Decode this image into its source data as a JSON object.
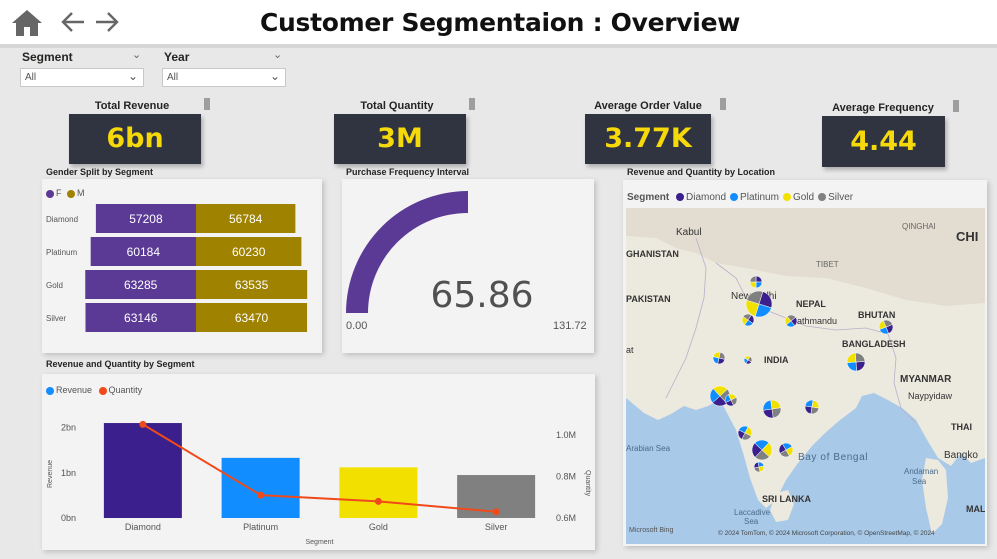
{
  "title": "Customer Segmentaion : Overview",
  "filters": {
    "segment": {
      "label": "Segment",
      "value": "All"
    },
    "year": {
      "label": "Year",
      "value": "All"
    }
  },
  "kpis": {
    "revenue": {
      "label": "Total Revenue",
      "value": "6bn"
    },
    "quantity": {
      "label": "Total Quantity",
      "value": "3M"
    },
    "aov": {
      "label": "Average Order Value",
      "value": "3.77K"
    },
    "frequency": {
      "label": "Average Frequency",
      "value": "4.44"
    }
  },
  "gender": {
    "title": "Gender Split by Segment",
    "legend": [
      "F",
      "M"
    ],
    "colors": {
      "F": "#5b3a96",
      "M": "#9e8200"
    },
    "rows": [
      {
        "segment": "Diamond",
        "f": 57208,
        "m": 56784
      },
      {
        "segment": "Platinum",
        "f": 60184,
        "m": 60230
      },
      {
        "segment": "Gold",
        "f": 63285,
        "m": 63535
      },
      {
        "segment": "Silver",
        "f": 63146,
        "m": 63470
      }
    ]
  },
  "gauge": {
    "title": "Purchase Frequency Interval",
    "value": 65.86,
    "value_label": "65.86",
    "min_label": "0.00",
    "max_label": "131.72",
    "color": "#5b3a96"
  },
  "combo": {
    "title": "Revenue and Quantity by Segment",
    "legend": {
      "revenue": "Revenue",
      "quantity": "Quantity"
    },
    "left_axis_title": "Revenue",
    "right_axis_title": "Quantity",
    "x_axis_title": "Segment",
    "left_ticks": [
      "2bn",
      "1bn",
      "0bn"
    ],
    "right_ticks": [
      "1.0M",
      "0.8M",
      "0.6M"
    ]
  },
  "map": {
    "title": "Revenue and Quantity by Location",
    "legend_title": "Segment",
    "legend_items": [
      {
        "name": "Diamond",
        "color": "#3b1f8c"
      },
      {
        "name": "Platinum",
        "color": "#118dff"
      },
      {
        "name": "Gold",
        "color": "#f2e100"
      },
      {
        "name": "Silver",
        "color": "#808080"
      }
    ],
    "labels": {
      "kabul": "Kabul",
      "afghanistan": "GHANISTAN",
      "pakistan": "PAKISTAN",
      "new_delhi": "New Delhi",
      "nepal": "NEPAL",
      "kathmandu": "Kathmandu",
      "bhutan": "BHUTAN",
      "bangladesh": "BANGLADESH",
      "india": "INDIA",
      "myanmar": "MYANMAR",
      "naypyidaw": "Naypyidaw",
      "tibet": "TIBET",
      "qinghai": "QINGHAI",
      "china": "CHI",
      "arabian_sea": "Arabian Sea",
      "bay_of_bengal": "Bay of Bengal",
      "sri_lanka": "SRI LANKA",
      "laccadive_sea_1": "Laccadive",
      "laccadive_sea_2": "Sea",
      "andaman_sea_1": "Andaman",
      "andaman_sea_2": "Sea",
      "thailand": "THAI",
      "bangkok": "Bangko",
      "maldives": "MAL",
      "at": "at"
    },
    "attribution_logo": "Microsoft Bing",
    "attribution": "© 2024 TomTom, © 2024 Microsoft Corporation, © OpenStreetMap, © 2024"
  },
  "chart_data": [
    {
      "type": "bar",
      "title": "Gender Split by Segment",
      "categories": [
        "Diamond",
        "Platinum",
        "Gold",
        "Silver"
      ],
      "series": [
        {
          "name": "F",
          "values": [
            57208,
            60184,
            63285,
            63146
          ]
        },
        {
          "name": "M",
          "values": [
            56784,
            60230,
            63535,
            63470
          ]
        }
      ]
    },
    {
      "type": "bar",
      "title": "Revenue and Quantity by Segment",
      "categories": [
        "Diamond",
        "Platinum",
        "Gold",
        "Silver"
      ],
      "xlabel": "Segment",
      "ylabel": "Revenue",
      "y2label": "Quantity",
      "ylim": [
        0,
        2.3
      ],
      "y2lim": [
        0.6,
        1.1
      ],
      "series": [
        {
          "name": "Revenue",
          "type": "bar",
          "axis": "left",
          "values": [
            2.1,
            1.33,
            1.12,
            0.95
          ],
          "colors": [
            "#3b1f8c",
            "#118dff",
            "#f2e100",
            "#808080"
          ]
        },
        {
          "name": "Quantity",
          "type": "line",
          "axis": "right",
          "values": [
            1.05,
            0.71,
            0.68,
            0.63
          ],
          "color": "#f04a1a"
        }
      ]
    }
  ]
}
